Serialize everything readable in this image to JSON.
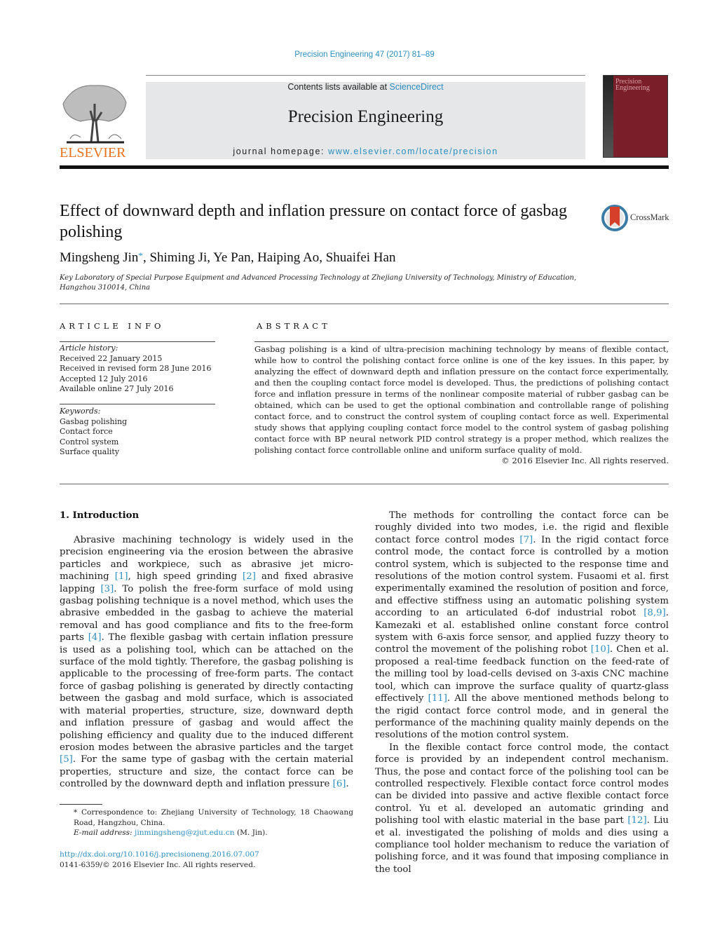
{
  "header": {
    "citation": "Precision Engineering 47 (2017) 81–89",
    "contents_prefix": "Contents lists available at ",
    "contents_link": "ScienceDirect",
    "journal_title": "Precision Engineering",
    "homepage_prefix": "journal homepage: ",
    "homepage_link": "www.elsevier.com/locate/precision",
    "publisher_logo_text": "ELSEVIER",
    "cover_title_line1": "Precision",
    "cover_title_line2": "Engineering",
    "colors": {
      "link": "#2a8fc1",
      "elsevier_orange": "#e9711c",
      "cover_red": "#7a1f2a",
      "banner_gray": "#e6e7e8"
    }
  },
  "article": {
    "title": "Effect of downward depth and inflation pressure on contact force of gasbag polishing",
    "crossmark_label": "CrossMark",
    "authors": [
      {
        "name": "Mingsheng Jin",
        "mark": "*"
      },
      {
        "name": "Shiming Ji"
      },
      {
        "name": "Ye Pan"
      },
      {
        "name": "Haiping Ao"
      },
      {
        "name": "Shuaifei Han"
      }
    ],
    "affiliation": "Key Laboratory of Special Purpose Equipment and Advanced Processing Technology at Zhejiang University of Technology, Ministry of Education, Hangzhou 310014, China"
  },
  "article_info": {
    "heading": "ARTICLE INFO",
    "history_label": "Article history:",
    "history": [
      "Received 22 January 2015",
      "Received in revised form 28 June 2016",
      "Accepted 12 July 2016",
      "Available online 27 July 2016"
    ],
    "keywords_label": "Keywords:",
    "keywords": [
      "Gasbag polishing",
      "Contact force",
      "Control system",
      "Surface quality"
    ]
  },
  "abstract": {
    "heading": "ABSTRACT",
    "text": "Gasbag polishing is a kind of ultra-precision machining technology by means of flexible contact, while how to control the polishing contact force online is one of the key issues. In this paper, by analyzing the effect of downward depth and inflation pressure on the contact force experimentally, and then the coupling contact force model is developed. Thus, the predictions of polishing contact force and inflation pressure in terms of the nonlinear composite material of rubber gasbag can be obtained, which can be used to get the optional combination and controllable range of polishing contact force, and to construct the control system of coupling contact force as well. Experimental study shows that applying coupling contact force model to the control system of gasbag polishing contact force with BP neural network PID control strategy is a proper method, which realizes the polishing contact force controllable online and uniform surface quality of mold.",
    "copyright": "© 2016 Elsevier Inc. All rights reserved."
  },
  "body": {
    "section_heading": "1.  Introduction",
    "left_paragraphs": [
      [
        {
          "t": "Abrasive machining technology is widely used in the precision engineering via the erosion between the abrasive particles and workpiece, such as abrasive jet micro-machining "
        },
        {
          "ref": "[1]"
        },
        {
          "t": ", high speed grinding "
        },
        {
          "ref": "[2]"
        },
        {
          "t": " and fixed abrasive lapping "
        },
        {
          "ref": "[3]"
        },
        {
          "t": ". To polish the free-form surface of mold using gasbag polishing technique is a novel method, which uses the abrasive embedded in the gasbag to achieve the material removal and has good compliance and fits to the free-form parts "
        },
        {
          "ref": "[4]"
        },
        {
          "t": ". The flexible gasbag with certain inflation pressure is used as a polishing tool, which can be attached on the surface of the mold tightly. Therefore, the gasbag polishing is applicable to the processing of free-form parts. The contact force of gasbag polishing is generated by directly contacting between the gasbag and mold surface, which is associated with material properties, structure, size, downward depth and inflation pressure of gasbag and would affect the polishing efficiency and quality due to the induced different erosion modes between the abrasive particles and the target "
        },
        {
          "ref": "[5]"
        },
        {
          "t": ". For the same type of gasbag with the certain material properties, structure and size, the contact force can be controlled by the downward depth and inflation pressure "
        },
        {
          "ref": "[6]"
        },
        {
          "t": "."
        }
      ]
    ],
    "right_paragraphs": [
      [
        {
          "t": "The methods for controlling the contact force can be roughly divided into two modes, i.e. the rigid and flexible contact force control modes "
        },
        {
          "ref": "[7]"
        },
        {
          "t": ". In the rigid contact force control mode, the contact force is controlled by a motion control system, which is subjected to the response time and resolutions of the motion control system. Fusaomi et al. first experimentally examined the resolution of position and force, and effective stiffness using an automatic polishing system according to an articulated 6-dof industrial robot "
        },
        {
          "ref": "[8,9]"
        },
        {
          "t": ". Kamezaki et al. established online constant force control system with 6-axis force sensor, and applied fuzzy theory to control the movement of the polishing robot "
        },
        {
          "ref": "[10]"
        },
        {
          "t": ". Chen et al. proposed a real-time feedback function on the feed-rate of the milling tool by load-cells devised on 3-axis CNC machine tool, which can improve the surface quality of quartz-glass effectively "
        },
        {
          "ref": "[11]"
        },
        {
          "t": ". All the above mentioned methods belong to the rigid contact force control mode, and in general the performance of the machining quality mainly depends on the resolutions of the motion control system."
        }
      ],
      [
        {
          "t": "In the flexible contact force control mode, the contact force is provided by an independent control mechanism. Thus, the pose and contact force of the polishing tool can be controlled respectively. Flexible contact force control modes can be divided into passive and active flexible contact force control. Yu et al. developed an automatic grinding and polishing tool with elastic material in the base part "
        },
        {
          "ref": "[12]"
        },
        {
          "t": ". Liu et al. investigated the polishing of molds and dies using a compliance tool holder mechanism to reduce the variation of polishing force, and it was found that imposing compliance in the tool"
        }
      ]
    ]
  },
  "footnotes": {
    "correspondence": "* Correspondence to: Zhejiang University of Technology, 18 Chaowang Road, Hangzhou, China.",
    "email_label": "E-mail address: ",
    "email": "jinmingsheng@zjut.edu.cn",
    "email_suffix": " (M. Jin).",
    "doi": "http://dx.doi.org/10.1016/j.precisioneng.2016.07.007",
    "issn_copyright": "0141-6359/© 2016 Elsevier Inc. All rights reserved."
  }
}
